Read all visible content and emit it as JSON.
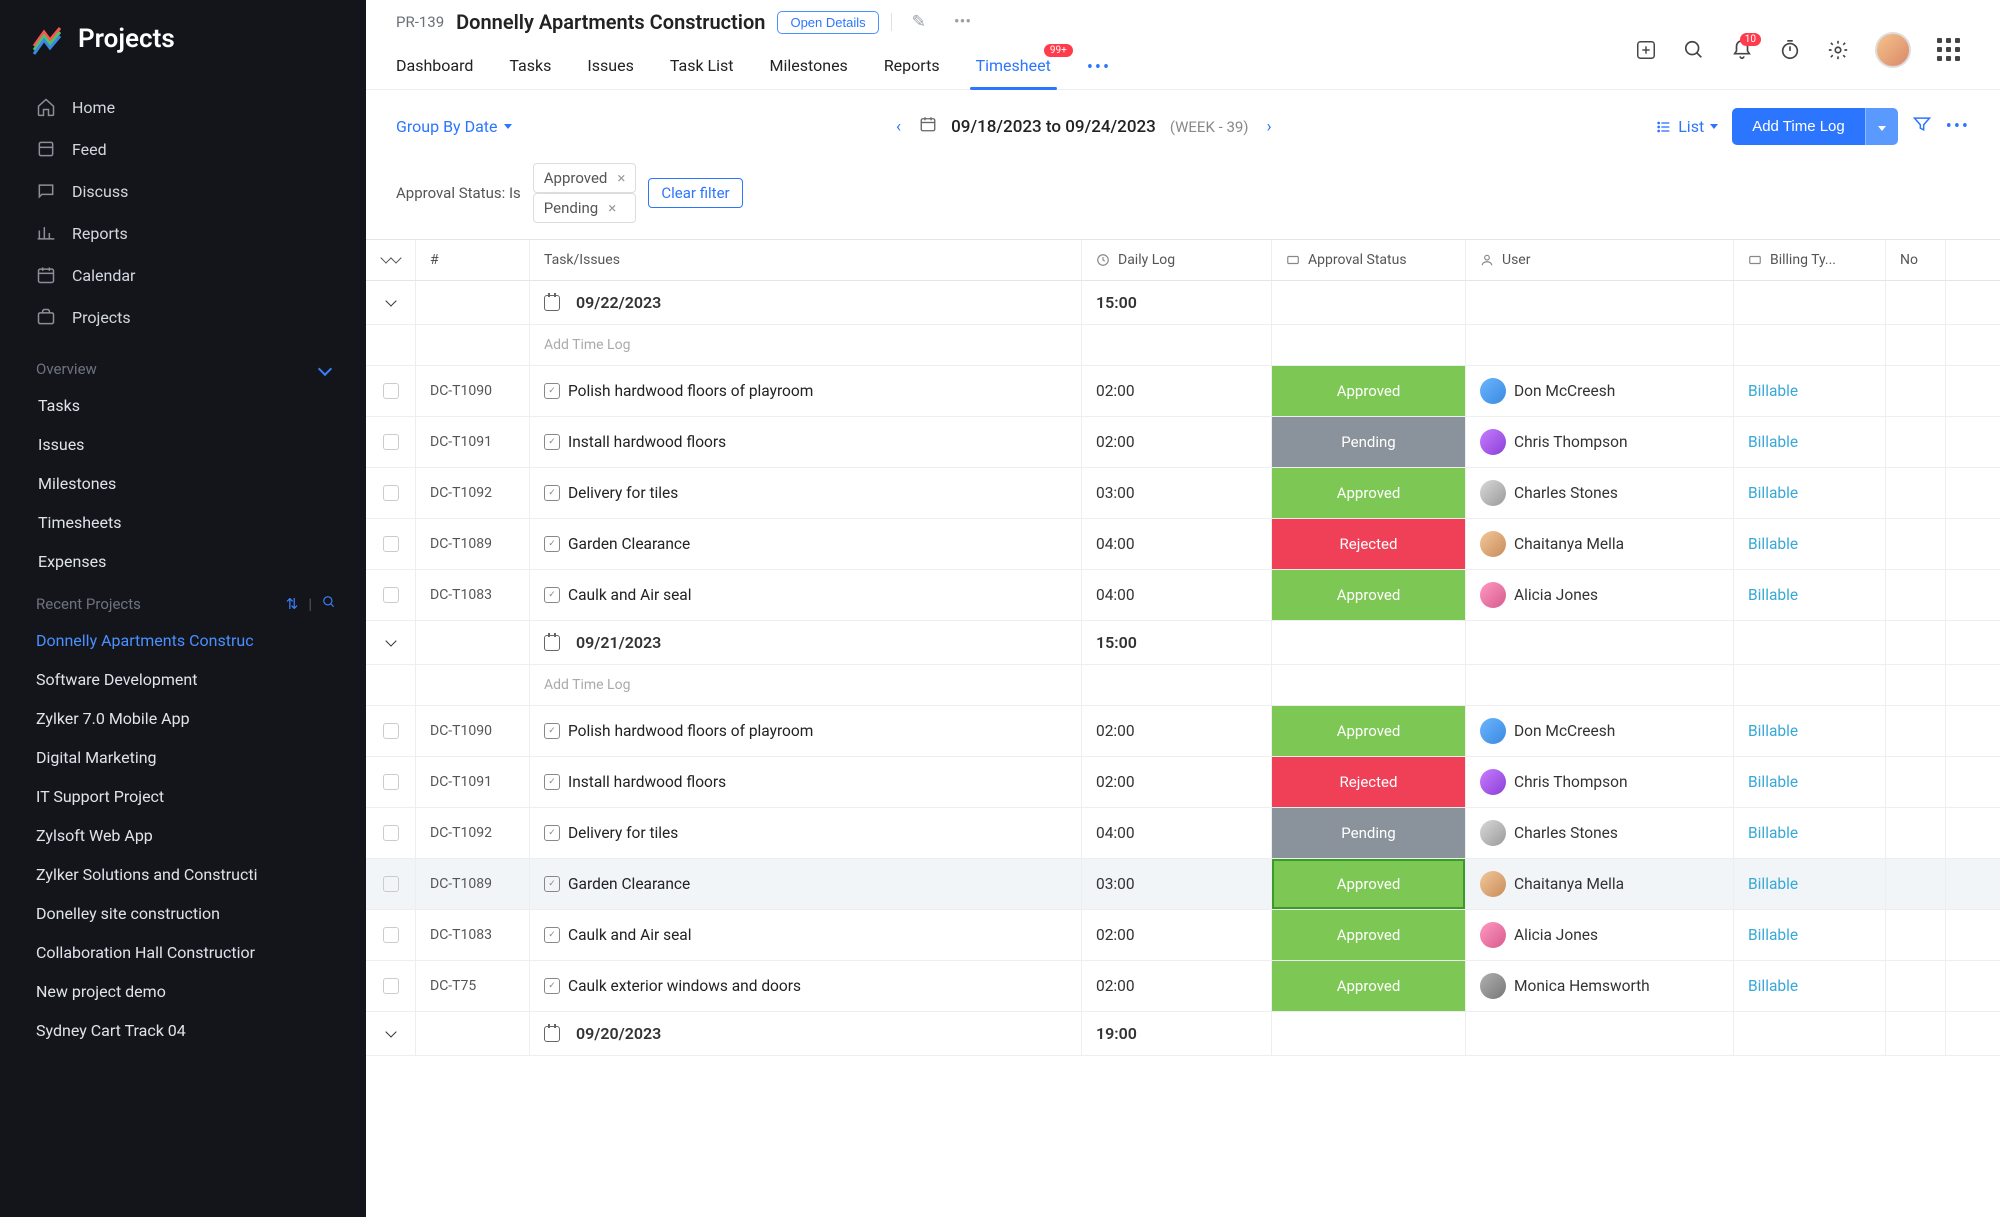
{
  "brand": {
    "name": "Projects"
  },
  "sidebar": {
    "nav": [
      {
        "label": "Home"
      },
      {
        "label": "Feed"
      },
      {
        "label": "Discuss"
      },
      {
        "label": "Reports"
      },
      {
        "label": "Calendar"
      },
      {
        "label": "Projects"
      }
    ],
    "overview_label": "Overview",
    "overview_items": [
      {
        "label": "Tasks"
      },
      {
        "label": "Issues"
      },
      {
        "label": "Milestones"
      },
      {
        "label": "Timesheets"
      },
      {
        "label": "Expenses"
      }
    ],
    "recent_label": "Recent Projects",
    "recent_items": [
      {
        "label": "Donnelly Apartments Construc",
        "active": true
      },
      {
        "label": "Software Development"
      },
      {
        "label": "Zylker 7.0 Mobile App"
      },
      {
        "label": "Digital Marketing"
      },
      {
        "label": "IT Support Project"
      },
      {
        "label": "Zylsoft Web App"
      },
      {
        "label": "Zylker Solutions and Constructi"
      },
      {
        "label": "Donelley site construction"
      },
      {
        "label": "Collaboration Hall Constructior"
      },
      {
        "label": "New project demo"
      },
      {
        "label": "Sydney Cart Track 04"
      }
    ]
  },
  "header": {
    "project_id": "PR-139",
    "project_title": "Donnelly Apartments Construction",
    "open_details": "Open Details",
    "tabs": [
      {
        "label": "Dashboard"
      },
      {
        "label": "Tasks"
      },
      {
        "label": "Issues"
      },
      {
        "label": "Task List"
      },
      {
        "label": "Milestones"
      },
      {
        "label": "Reports"
      },
      {
        "label": "Timesheet",
        "badge": "99+",
        "active": true
      }
    ],
    "bell_badge": "10"
  },
  "toolbar": {
    "group_by": "Group By Date",
    "date_range": "09/18/2023 to 09/24/2023",
    "week_label": "(WEEK - 39)",
    "view_mode": "List",
    "add_log": "Add Time Log"
  },
  "filter": {
    "label": "Approval Status: Is",
    "chips": [
      "Approved",
      "Pending"
    ],
    "clear": "Clear filter"
  },
  "columns": {
    "num": "#",
    "task": "Task/Issues",
    "log": "Daily Log",
    "status": "Approval Status",
    "user": "User",
    "billing": "Billing Ty...",
    "notes": "No"
  },
  "add_time_log_text": "Add Time Log",
  "status_labels": {
    "approved": "Approved",
    "pending": "Pending",
    "rejected": "Rejected"
  },
  "groups": [
    {
      "date": "09/22/2023",
      "total": "15:00",
      "rows": [
        {
          "id": "DC-T1090",
          "task": "Polish hardwood floors of playroom",
          "log": "02:00",
          "status": "approved",
          "user": "Don McCreesh",
          "av": 0,
          "billing": "Billable"
        },
        {
          "id": "DC-T1091",
          "task": "Install hardwood floors",
          "log": "02:00",
          "status": "pending",
          "user": "Chris Thompson",
          "av": 1,
          "billing": "Billable"
        },
        {
          "id": "DC-T1092",
          "task": "Delivery for tiles",
          "log": "03:00",
          "status": "approved",
          "user": "Charles Stones",
          "av": 2,
          "billing": "Billable"
        },
        {
          "id": "DC-T1089",
          "task": "Garden Clearance",
          "log": "04:00",
          "status": "rejected",
          "user": "Chaitanya Mella",
          "av": 3,
          "billing": "Billable"
        },
        {
          "id": "DC-T1083",
          "task": "Caulk and Air seal",
          "log": "04:00",
          "status": "approved",
          "user": "Alicia Jones",
          "av": 4,
          "billing": "Billable"
        }
      ]
    },
    {
      "date": "09/21/2023",
      "total": "15:00",
      "rows": [
        {
          "id": "DC-T1090",
          "task": "Polish hardwood floors of playroom",
          "log": "02:00",
          "status": "approved",
          "user": "Don McCreesh",
          "av": 0,
          "billing": "Billable"
        },
        {
          "id": "DC-T1091",
          "task": "Install hardwood floors",
          "log": "02:00",
          "status": "rejected",
          "user": "Chris Thompson",
          "av": 1,
          "billing": "Billable"
        },
        {
          "id": "DC-T1092",
          "task": "Delivery for tiles",
          "log": "04:00",
          "status": "pending",
          "user": "Charles Stones",
          "av": 2,
          "billing": "Billable"
        },
        {
          "id": "DC-T1089",
          "task": "Garden Clearance",
          "log": "03:00",
          "status": "approved",
          "user": "Chaitanya Mella",
          "av": 3,
          "billing": "Billable",
          "highlight": true
        },
        {
          "id": "DC-T1083",
          "task": "Caulk and Air seal",
          "log": "02:00",
          "status": "approved",
          "user": "Alicia Jones",
          "av": 4,
          "billing": "Billable"
        },
        {
          "id": "DC-T75",
          "task": "Caulk exterior windows and doors",
          "log": "02:00",
          "status": "approved",
          "user": "Monica Hemsworth",
          "av": 5,
          "billing": "Billable"
        }
      ]
    },
    {
      "date": "09/20/2023",
      "total": "19:00",
      "rows": []
    }
  ]
}
